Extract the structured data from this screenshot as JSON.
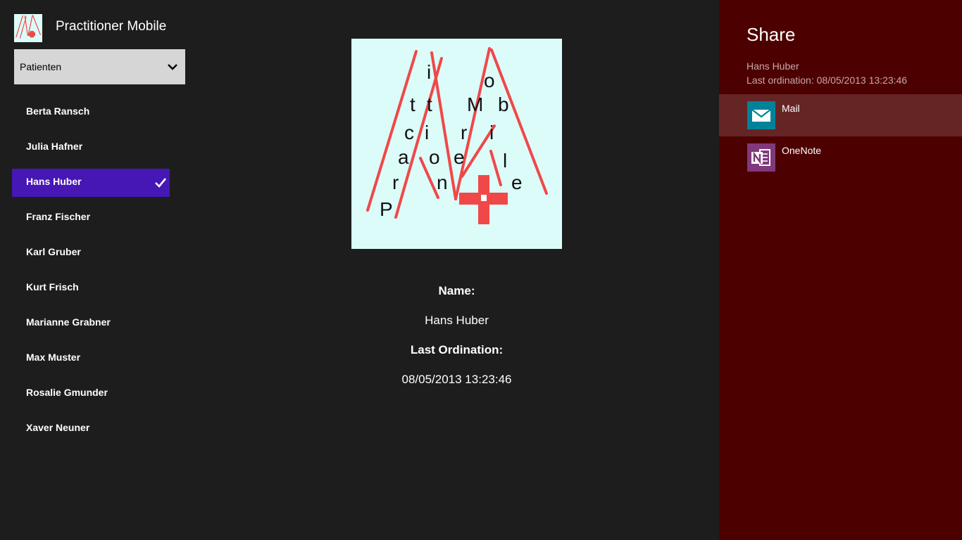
{
  "app": {
    "title": "Practitioner Mobile"
  },
  "dropdown": {
    "selected": "Patienten"
  },
  "patients": [
    {
      "name": "Berta Ransch",
      "selected": false
    },
    {
      "name": "Julia Hafner",
      "selected": false
    },
    {
      "name": "Hans Huber",
      "selected": true
    },
    {
      "name": "Franz Fischer",
      "selected": false
    },
    {
      "name": "Karl Gruber",
      "selected": false
    },
    {
      "name": "Kurt Frisch",
      "selected": false
    },
    {
      "name": "Marianne Grabner",
      "selected": false
    },
    {
      "name": "Max Muster",
      "selected": false
    },
    {
      "name": "Rosalie Gmunder",
      "selected": false
    },
    {
      "name": "Xaver Neuner",
      "selected": false
    }
  ],
  "details": {
    "name_label": "Name:",
    "name_value": "Hans Huber",
    "ordination_label": "Last Ordination:",
    "ordination_value": "08/05/2013 13:23:46"
  },
  "share": {
    "title": "Share",
    "item_title": "Hans Huber",
    "item_description": "Last ordination: 08/05/2013 13:23:46",
    "targets": [
      {
        "label": "Mail",
        "icon": "mail-icon",
        "selected": true
      },
      {
        "label": "OneNote",
        "icon": "onenote-icon",
        "selected": false
      }
    ]
  },
  "logo_text": [
    "Practitioner",
    "Mobile"
  ],
  "colors": {
    "selection": "#4617b4",
    "share_background": "#4d0000",
    "logo_red": "#f04848",
    "mail_tile": "#008299",
    "onenote_tile": "#80397b"
  }
}
